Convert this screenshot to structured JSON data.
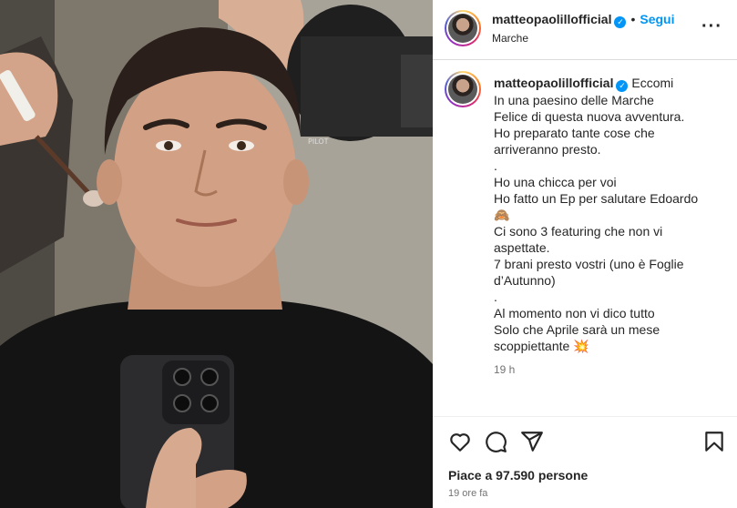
{
  "post": {
    "username": "matteopaolillofficial",
    "verified_mark": "✓",
    "separator": "•",
    "follow_label": "Segui",
    "location": "Marche",
    "more_label": "···"
  },
  "caption": {
    "username": "matteopaolillofficial",
    "lines": [
      "Eccomi",
      "In una paesino delle Marche",
      "Felice di questa nuova avventura.",
      "Ho preparato tante cose che",
      "arriveranno presto.",
      ".",
      "Ho una chicca per voi",
      "Ho fatto un Ep per salutare Edoardo",
      "🙈",
      "Ci sono 3 featuring che non vi",
      "aspettate.",
      "7 brani presto vostri (uno è Foglie",
      "d’Autunno)",
      ".",
      "Al momento non vi dico tutto",
      "Solo che Aprile sarà un mese",
      "scoppiettante 💥"
    ],
    "time": "19 h"
  },
  "actions": {
    "like_icon": "heart-icon",
    "comment_icon": "comment-icon",
    "share_icon": "share-icon",
    "save_icon": "bookmark-icon"
  },
  "likes": "Piace a 97.590 persone",
  "posted_ago": "19 ore fa",
  "photo": {
    "light_brand": "PILOT"
  },
  "colors": {
    "link_blue": "#0095f6",
    "text": "#262626",
    "muted": "#737373",
    "divider": "#dbdbdb"
  }
}
